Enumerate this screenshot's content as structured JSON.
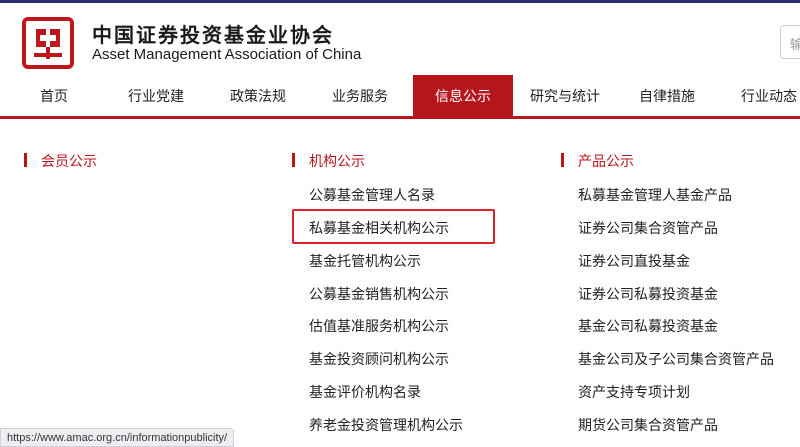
{
  "header": {
    "brand_cn": "中国证券投资基金业协会",
    "brand_en": "Asset Management Association of China",
    "logo_icon": "amac-seal-logo",
    "search_placeholder": "输"
  },
  "nav": {
    "items": [
      {
        "label": "首页"
      },
      {
        "label": "行业党建"
      },
      {
        "label": "政策法规"
      },
      {
        "label": "业务服务"
      },
      {
        "label": "信息公示"
      },
      {
        "label": "研究与统计"
      },
      {
        "label": "自律措施"
      },
      {
        "label": "行业动态"
      }
    ],
    "active_index": 4
  },
  "columns": [
    {
      "title": "会员公示",
      "links": []
    },
    {
      "title": "机构公示",
      "links": [
        {
          "label": "公募基金管理人名录"
        },
        {
          "label": "私募基金相关机构公示"
        },
        {
          "label": "基金托管机构公示"
        },
        {
          "label": "公募基金销售机构公示"
        },
        {
          "label": "估值基准服务机构公示"
        },
        {
          "label": "基金投资顾问机构公示"
        },
        {
          "label": "基金评价机构名录"
        },
        {
          "label": "养老金投资管理机构公示"
        }
      ]
    },
    {
      "title": "产品公示",
      "links": [
        {
          "label": "私募基金管理人基金产品"
        },
        {
          "label": "证券公司集合资管产品"
        },
        {
          "label": "证券公司直投基金"
        },
        {
          "label": "证券公司私募投资基金"
        },
        {
          "label": "基金公司私募投资基金"
        },
        {
          "label": "基金公司及子公司集合资管产品"
        },
        {
          "label": "资产支持专项计划"
        },
        {
          "label": "期货公司集合资管产品"
        }
      ]
    }
  ],
  "status_bar": {
    "url": "https://www.amac.org.cn/informationpublicity/"
  },
  "colors": {
    "brand_red": "#b5161c",
    "highlight_red": "#e0202a"
  }
}
